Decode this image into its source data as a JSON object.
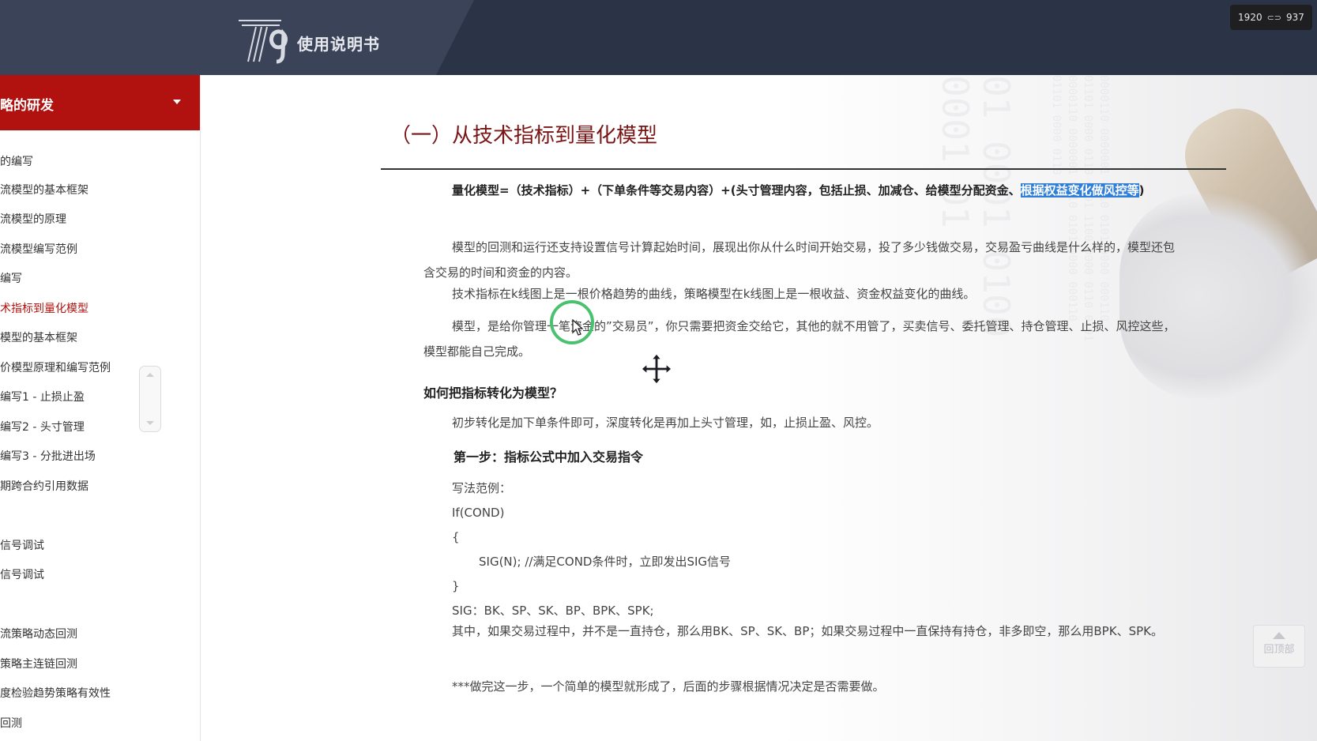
{
  "header": {
    "logo_text": "使用说明书",
    "resolution": {
      "width": "1920",
      "height": "937"
    }
  },
  "sidebar": {
    "section_title": "略的研发",
    "items": [
      "的编写",
      "流模型的基本框架",
      "流模型的原理",
      "流模型编写范例",
      "编写",
      "术指标到量化模型",
      "模型的基本框架",
      "价模型原理和编写范例",
      "编写1 - 止损止盈",
      "编写2 - 头寸管理",
      "编写3 - 分批进出场",
      "期跨合约引用数据",
      "信号调试",
      "信号调试",
      "流策略动态回测",
      "策略主连链回测",
      "度检验趋势策略有效性",
      "回测"
    ],
    "active_index": 5
  },
  "main": {
    "title": "（一）从技术指标到量化模型",
    "p1_prefix": "量化模型=（技术指标）+（下单条件等交易内容）+(头寸管理内容，包括止损、加减仓、给模型分配资金、",
    "p1_highlight_a": "根据权益",
    "p1_highlight_b": "变化做风控等",
    "p1_suffix": ")",
    "p2": "模型的回测和运行还支持设置信号计算起始时间，展现出你从什么时间开始交易，投了多少钱做交易，交易盈亏曲线是什么样的，模型还包含交易的时间和资金的内容。",
    "p3": "技术指标在k线图上是一根价格趋势的曲线，策略模型在k线图上是一根收益、资金权益变化的曲线。",
    "p4": "模型，是给你管理一笔资金的”交易员”，你只需要把资金交给它，其他的就不用管了，买卖信号、委托管理、持仓管理、止损、风控这些，模型都能自己完成。",
    "h3": "如何把指标转化为模型？",
    "p5": "初步转化是加下单条件即可，深度转化是再加上头寸管理，如，止损止盈、风控。",
    "h4": "第一步：指标公式中加入交易指令",
    "code_label": "写法范例：",
    "code_line1": "If(COND)",
    "code_line2": "{",
    "code_line3": "SIG(N); //满足COND条件时，立即发出SIG信号",
    "code_line4": "}",
    "code_line5": "SIG：BK、SP、SK、BP、BPK、SPK;",
    "p6": "其中，如果交易过程中，并不是一直持仓，那么用BK、SP、SK、BP；如果交易过程中一直保持有持仓，非多即空，那么用BPK、SPK。",
    "p7": "***做完这一步，一个简单的模型就形成了，后面的步骤根据情况决定是否需要做。",
    "back_to_top": "回顶部"
  }
}
